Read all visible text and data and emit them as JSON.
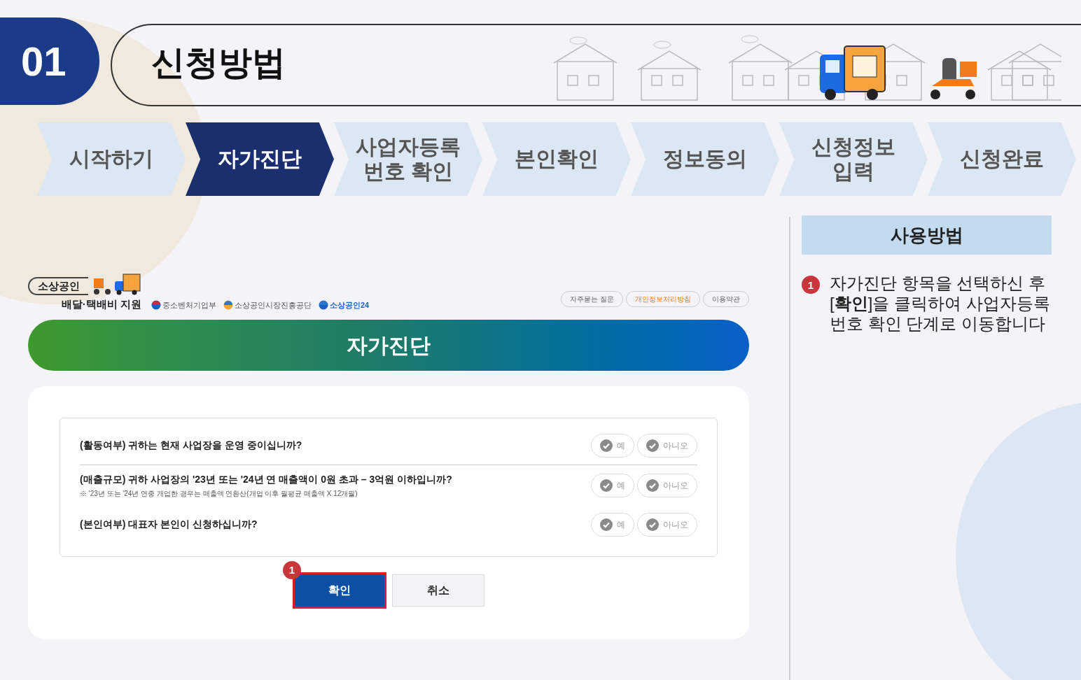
{
  "header": {
    "number": "01",
    "title": "신청방법"
  },
  "steps": [
    {
      "label": "시작하기",
      "selected": false
    },
    {
      "label": "자가진단",
      "selected": true
    },
    {
      "label": "사업자등록\n번호 확인",
      "selected": false
    },
    {
      "label": "본인확인",
      "selected": false
    },
    {
      "label": "정보동의",
      "selected": false
    },
    {
      "label": "신청정보\n입력",
      "selected": false
    },
    {
      "label": "신청완료",
      "selected": false
    }
  ],
  "screenshot": {
    "logo": {
      "badge": "소상공인",
      "subtitle": "배달·택배비 지원"
    },
    "agencies": [
      "중소벤처기업부",
      "소상공인시장진흥공단",
      "소상공인24"
    ],
    "links": [
      {
        "label": "자주묻는 질문",
        "highlighted": false
      },
      {
        "label": "개인정보처리방침",
        "highlighted": true
      },
      {
        "label": "이용약관",
        "highlighted": false
      }
    ],
    "banner": "자가진단",
    "questions": [
      {
        "text": "(활동여부) 귀하는 현재 사업장을 운영 중이십니까?",
        "options": [
          {
            "label": "예",
            "selected": false
          },
          {
            "label": "아니오",
            "selected": false
          }
        ]
      },
      {
        "text": "(매출규모) 귀하 사업장의 '23년 또는 '24년 연 매출액이 0원 초과 – 3억원 이하입니까?",
        "note": "※ '23년 또는 '24년 연중 개업한 경우는 매출액 연환산(개업 이후 월평균 매출액 X 12개월)",
        "options": [
          {
            "label": "예",
            "selected": false
          },
          {
            "label": "아니오",
            "selected": false
          }
        ]
      },
      {
        "text": "(본인여부) 대표자 본인이 신청하십니까?",
        "options": [
          {
            "label": "예",
            "selected": false
          },
          {
            "label": "아니오",
            "selected": false
          }
        ]
      }
    ],
    "buttons": [
      {
        "label": "확인",
        "kind": "primary",
        "marker": "1"
      },
      {
        "label": "취소",
        "kind": "secondary"
      }
    ]
  },
  "guide": {
    "title": "사용방법",
    "items": [
      {
        "marker": "1",
        "text": "자가진단 항목을 선택하신 후 [**확인**]을 클릭하여 사업자등록 번호 확인 단계로 이동합니다"
      }
    ]
  }
}
